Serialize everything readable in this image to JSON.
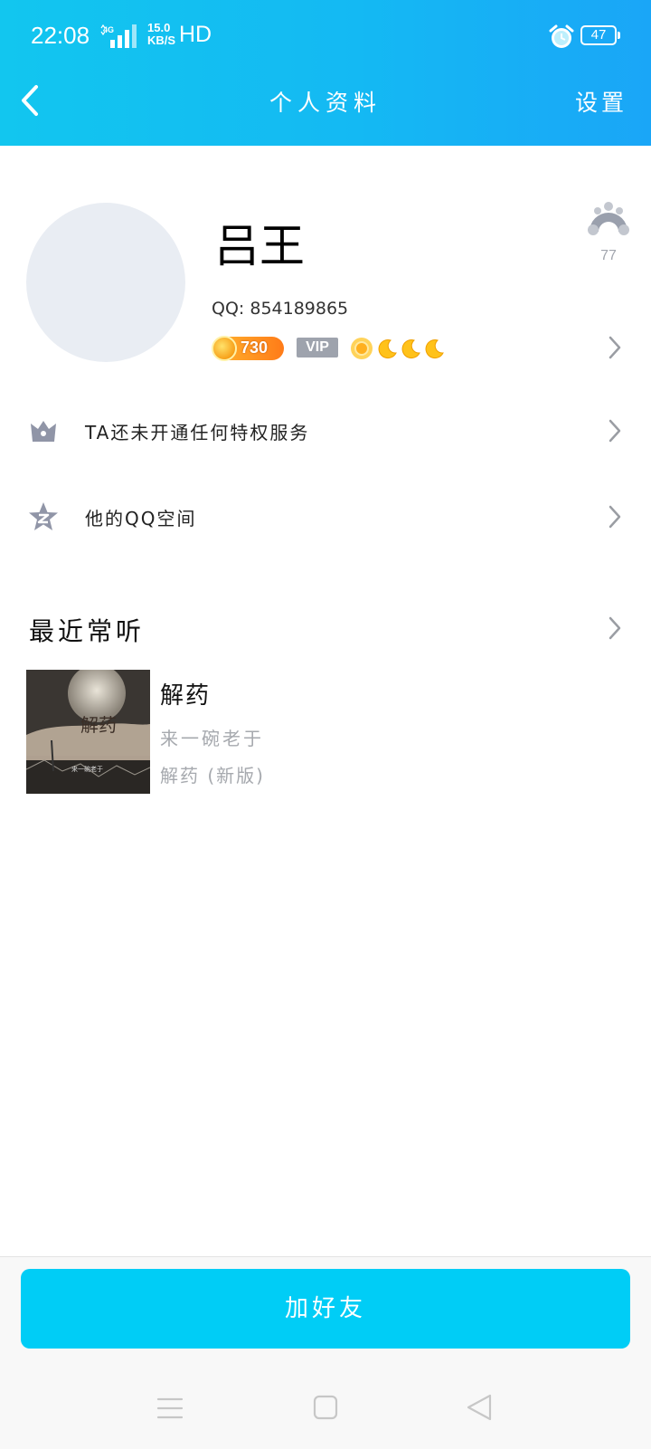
{
  "status_bar": {
    "time": "22:08",
    "network_type": "4G",
    "speed_value": "15.0",
    "speed_unit": "KB/S",
    "hd_label": "HD",
    "battery_level": "47",
    "icons": [
      "signal-icon",
      "alarm-icon",
      "battery-icon"
    ]
  },
  "nav": {
    "title": "个人资料",
    "settings_label": "设置",
    "back_icon": "chevron-left-icon"
  },
  "profile": {
    "name": "吕王",
    "qq_label": "QQ: 854189865",
    "level_badge_number": "730",
    "vip_label": "VIP",
    "level_icons": [
      "sun-icon",
      "moon-icon",
      "moon-icon",
      "moon-icon"
    ],
    "like_count": "77",
    "like_icon": "rainbow-icon"
  },
  "rows": [
    {
      "label": "TA还未开通任何特权服务",
      "icon": "crown-icon"
    },
    {
      "label": "他的QQ空间",
      "icon": "qzone-star-icon"
    }
  ],
  "recent": {
    "title": "最近常听",
    "song": {
      "title": "解药",
      "artist": "来一碗老于",
      "album": "解药 (新版)",
      "cover_text": "解药",
      "cover_caption": "来一碗老于"
    }
  },
  "actions": {
    "add_friend": "加好友"
  },
  "colors": {
    "header_start": "#12c6ef",
    "header_end": "#1aa6f7",
    "button": "#00cdf6",
    "secondary_text": "#a6a9ae",
    "icon_gray": "#9095a7"
  }
}
